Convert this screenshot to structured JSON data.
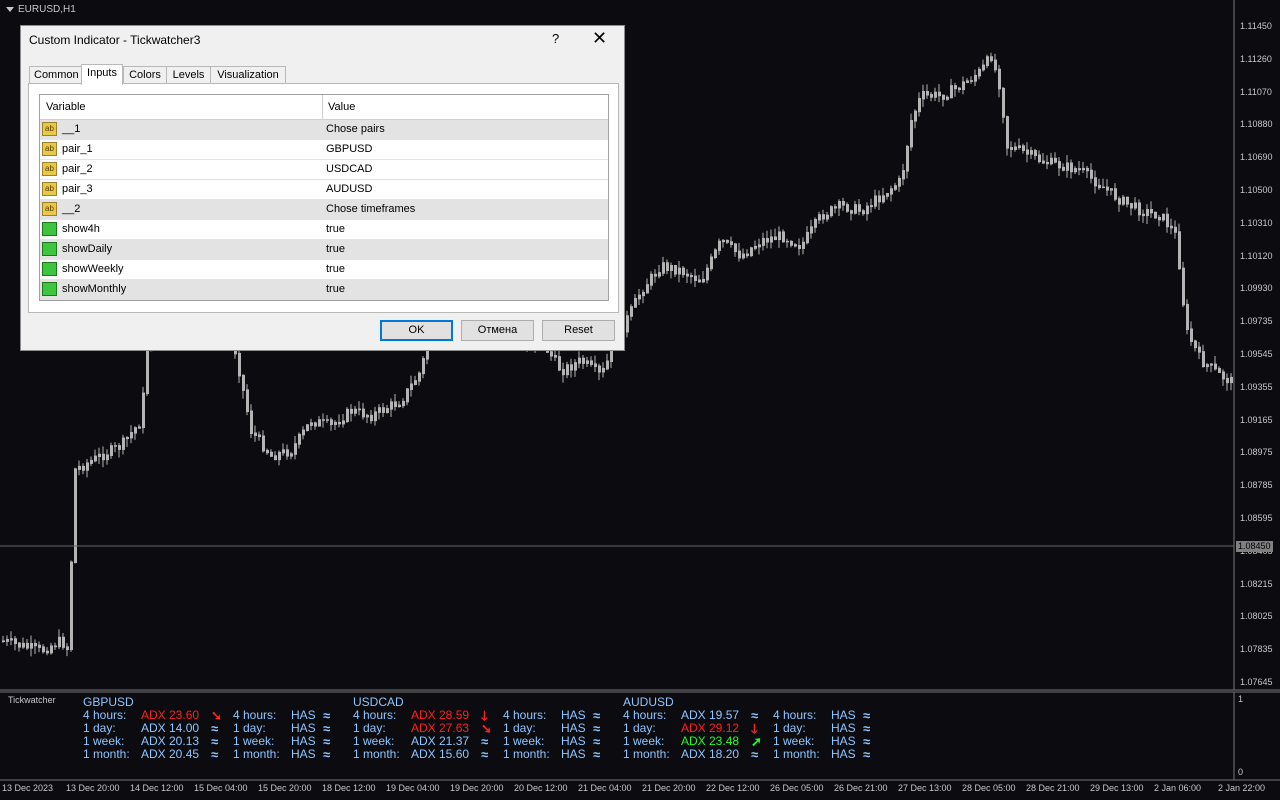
{
  "chart": {
    "symbol": "EURUSD,H1",
    "current_price": "1.08450",
    "price_ticks": [
      "1.11450",
      "1.11260",
      "1.11070",
      "1.10880",
      "1.10690",
      "1.10500",
      "1.10310",
      "1.10120",
      "1.09930",
      "1.09735",
      "1.09545",
      "1.09355",
      "1.09165",
      "1.08975",
      "1.08785",
      "1.08595",
      "1.08405",
      "1.08215",
      "1.08025",
      "1.07835",
      "1.07645"
    ],
    "time_ticks": [
      "13 Dec 2023",
      "13 Dec 20:00",
      "14 Dec 12:00",
      "15 Dec 04:00",
      "15 Dec 20:00",
      "18 Dec 12:00",
      "19 Dec 04:00",
      "19 Dec 20:00",
      "20 Dec 12:00",
      "21 Dec 04:00",
      "21 Dec 20:00",
      "22 Dec 12:00",
      "26 Dec 05:00",
      "26 Dec 21:00",
      "27 Dec 13:00",
      "28 Dec 05:00",
      "28 Dec 21:00",
      "29 Dec 13:00",
      "2 Jan 06:00",
      "2 Jan 22:00"
    ],
    "colors": {
      "candle": "#b4b4b4",
      "background": "#0b0b10",
      "text": "#c8c8c8"
    }
  },
  "indicator": {
    "name": "Tickwatcher",
    "scale_top": "1",
    "scale_bottom": "0",
    "panels": [
      {
        "pair": "GBPUSD",
        "rows": [
          {
            "period": "4 hours:",
            "adx": "ADX 23.60",
            "adx_color": "red",
            "arrow": "down-right-arrow-icon",
            "period2": "4 hours:",
            "has": "HAS"
          },
          {
            "period": "1 day:",
            "adx": "ADX 14.00",
            "adx_color": "blue",
            "arrow": "waves-icon",
            "period2": "1 day:",
            "has": "HAS"
          },
          {
            "period": "1 week:",
            "adx": "ADX 20.13",
            "adx_color": "blue",
            "arrow": "waves-icon",
            "period2": "1 week:",
            "has": "HAS"
          },
          {
            "period": "1 month:",
            "adx": "ADX 20.45",
            "adx_color": "blue",
            "arrow": "waves-icon",
            "period2": "1 month:",
            "has": "HAS"
          }
        ]
      },
      {
        "pair": "USDCAD",
        "rows": [
          {
            "period": "4 hours:",
            "adx": "ADX 28.59",
            "adx_color": "red",
            "arrow": "down-arrow-icon",
            "period2": "4 hours:",
            "has": "HAS"
          },
          {
            "period": "1 day:",
            "adx": "ADX 27.63",
            "adx_color": "red",
            "arrow": "down-right-arrow-icon",
            "period2": "1 day:",
            "has": "HAS"
          },
          {
            "period": "1 week:",
            "adx": "ADX 21.37",
            "adx_color": "blue",
            "arrow": "waves-icon",
            "period2": "1 week:",
            "has": "HAS"
          },
          {
            "period": "1 month:",
            "adx": "ADX 15.60",
            "adx_color": "blue",
            "arrow": "waves-icon",
            "period2": "1 month:",
            "has": "HAS"
          }
        ]
      },
      {
        "pair": "AUDUSD",
        "rows": [
          {
            "period": "4 hours:",
            "adx": "ADX 19.57",
            "adx_color": "blue",
            "arrow": "waves-icon",
            "period2": "4 hours:",
            "has": "HAS"
          },
          {
            "period": "1 day:",
            "adx": "ADX 29.12",
            "adx_color": "red",
            "arrow": "down-arrow-icon",
            "period2": "1 day:",
            "has": "HAS"
          },
          {
            "period": "1 week:",
            "adx": "ADX 23.48",
            "adx_color": "green",
            "arrow": "up-right-arrow-icon",
            "period2": "1 week:",
            "has": "HAS"
          },
          {
            "period": "1 month:",
            "adx": "ADX 18.20",
            "adx_color": "blue",
            "arrow": "waves-icon",
            "period2": "1 month:",
            "has": "HAS"
          }
        ]
      }
    ]
  },
  "dialog": {
    "title": "Custom Indicator - Tickwatcher3",
    "help": "?",
    "close": "✕",
    "tabs": [
      "Common",
      "Inputs",
      "Colors",
      "Levels",
      "Visualization"
    ],
    "active_tab": "Inputs",
    "grid": {
      "col_variable": "Variable",
      "col_value": "Value",
      "rows": [
        {
          "variable": "__1",
          "value": "Chose pairs",
          "type": "string"
        },
        {
          "variable": "pair_1",
          "value": "GBPUSD",
          "type": "string"
        },
        {
          "variable": "pair_2",
          "value": "USDCAD",
          "type": "string"
        },
        {
          "variable": "pair_3",
          "value": "AUDUSD",
          "type": "string"
        },
        {
          "variable": "__2",
          "value": "Chose timeframes",
          "type": "string"
        },
        {
          "variable": "show4h",
          "value": "true",
          "type": "bool"
        },
        {
          "variable": "showDaily",
          "value": "true",
          "type": "bool"
        },
        {
          "variable": "showWeekly",
          "value": "true",
          "type": "bool"
        },
        {
          "variable": "showMonthly",
          "value": "true",
          "type": "bool"
        }
      ]
    },
    "buttons": {
      "ok": "OK",
      "cancel": "Отмена",
      "reset": "Reset"
    }
  }
}
